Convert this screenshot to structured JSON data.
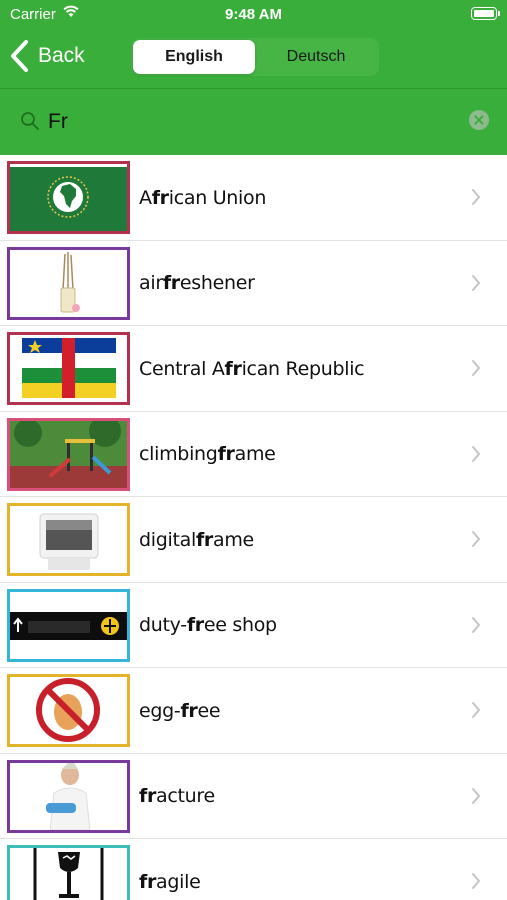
{
  "status_bar": {
    "carrier": "Carrier",
    "time": "9:48 AM"
  },
  "nav": {
    "back_label": "Back",
    "languages": [
      "English",
      "Deutsch"
    ],
    "selected_language": "English"
  },
  "search": {
    "query": "Fr"
  },
  "colors": {
    "header_green": "#3aae3a"
  },
  "items": [
    {
      "parts": [
        "A",
        "fr",
        "ican Union"
      ],
      "border": "#b3324e",
      "icon": "african-union-flag"
    },
    {
      "parts": [
        "air ",
        "fr",
        "eshener"
      ],
      "border": "#7a3a9a",
      "icon": "air-freshener"
    },
    {
      "parts": [
        "Central A",
        "fr",
        "ican Republic"
      ],
      "border": "#b3324e",
      "icon": "central-african-republic-flag"
    },
    {
      "parts": [
        "climbing ",
        "fr",
        "ame"
      ],
      "border": "#d9507a",
      "icon": "playground"
    },
    {
      "parts": [
        "digital ",
        "fr",
        "ame"
      ],
      "border": "#e3b32a",
      "icon": "digital-frame"
    },
    {
      "parts": [
        "duty-",
        "fr",
        "ee shop"
      ],
      "border": "#35b5d8",
      "icon": "duty-free-sign"
    },
    {
      "parts": [
        "egg-",
        "fr",
        "ee"
      ],
      "border": "#e3b32a",
      "icon": "no-egg-sign"
    },
    {
      "parts": [
        "",
        "fr",
        "acture"
      ],
      "border": "#7a3a9a",
      "icon": "fracture"
    },
    {
      "parts": [
        "",
        "fr",
        "agile"
      ],
      "border": "#3cbdb8",
      "icon": "fragile-sign"
    }
  ]
}
